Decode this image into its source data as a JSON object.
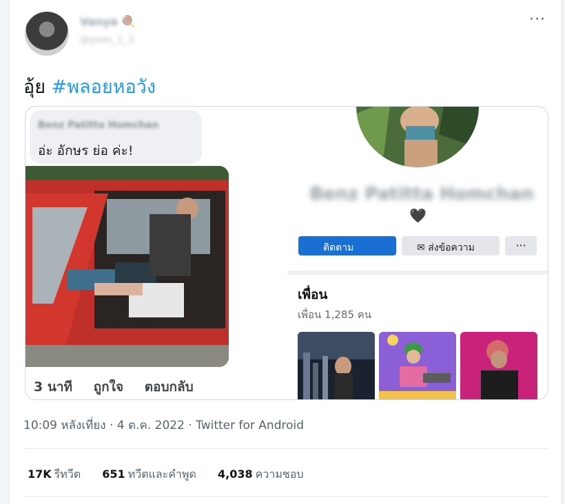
{
  "author": {
    "name": "Vanya",
    "emoji": "🍭",
    "handle": "@ysoo_1_3"
  },
  "tweet": {
    "text": "อุ้ย",
    "hashtag": "#พลอยหอวัง"
  },
  "embedded": {
    "comment": {
      "name": "Benz Patitta Homchan",
      "text": "อ่ะ อักษร ย่อ ค่ะ!"
    },
    "actions": [
      "3 นาที",
      "ถูกใจ",
      "ตอบกลับ"
    ],
    "profile": {
      "name": "Benz Patitta Homchan",
      "heart": "🖤",
      "follow_label": "ติดตาม",
      "message_label": "ส่งข้อความ",
      "more_label": "···"
    },
    "friends": {
      "title": "เพื่อน",
      "count": "เพื่อน 1,285 คน"
    }
  },
  "meta": "10:09 หลังเที่ยง · 4 ต.ค. 2022 · Twitter for Android",
  "stats": {
    "retweets_value": "17K",
    "retweets_label": "รีทวีต",
    "quotes_value": "651",
    "quotes_label": "ทวีตและคำพูด",
    "likes_value": "4,038",
    "likes_label": "ความชอบ"
  },
  "colors": {
    "link": "#1d9bf0",
    "follow_button": "#1a6fd4"
  }
}
